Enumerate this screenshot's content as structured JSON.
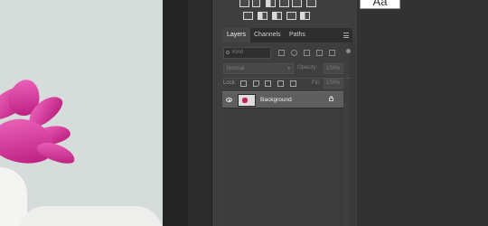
{
  "font_preview": {
    "text": "Aa"
  },
  "panel": {
    "tabs": [
      {
        "label": "Layers",
        "active": true
      },
      {
        "label": "Channels",
        "active": false
      },
      {
        "label": "Paths",
        "active": false
      }
    ],
    "menu_icon": "panel-menu-icon",
    "filter": {
      "kind_placeholder": "Kind",
      "icons": [
        "image-filter-icon",
        "adjustment-filter-icon",
        "type-filter-icon",
        "shape-filter-icon",
        "smart-object-filter-icon"
      ]
    },
    "blend": {
      "mode": "Normal",
      "opacity_label": "Opacity:",
      "opacity_value": "100%"
    },
    "lock": {
      "label": "Lock:",
      "icons": [
        "lock-transparent-icon",
        "lock-image-icon",
        "lock-position-icon",
        "lock-artboard-icon",
        "lock-all-icon"
      ],
      "fill_label": "Fill:",
      "fill_value": "100%"
    },
    "layers": [
      {
        "name": "Background",
        "visible": true,
        "locked": true
      }
    ]
  },
  "colors": {
    "panel_bg": "#3e3e3e",
    "selected_layer": "#5e5e5e",
    "flower": "#d3248f",
    "canvas_bg": "#d6dcd9"
  }
}
